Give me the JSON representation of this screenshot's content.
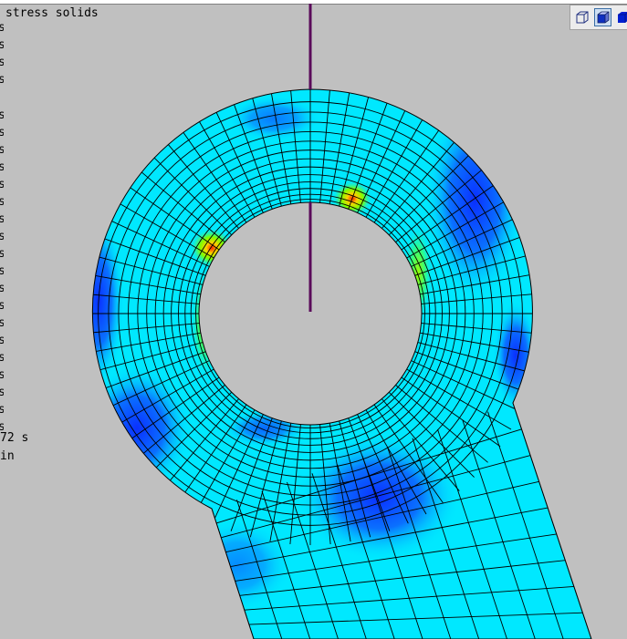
{
  "legend": {
    "title": "stress solids",
    "ticks": [
      "s",
      "s",
      "s",
      "s",
      "s",
      "s",
      "s",
      "s",
      "s",
      "s",
      "s",
      "s",
      "s",
      "s",
      "s",
      "s",
      "s",
      "s",
      "s",
      "s",
      "s",
      "s",
      "s"
    ]
  },
  "info": {
    "time_label": "72 s",
    "unit_label": "in"
  },
  "toolbar": {
    "buttons": [
      {
        "name": "wireframe-view-icon",
        "active": false
      },
      {
        "name": "shaded-view-icon",
        "active": true
      },
      {
        "name": "solid-view-icon",
        "active": false
      }
    ]
  },
  "colors": {
    "background": "#c0c0c0",
    "mesh_lines": "#000000",
    "axis_line": "#5a0a5a",
    "stress_low": "#0a3cff",
    "stress_base": "#00e8ff",
    "stress_mid": "#7cff00",
    "stress_high": "#ff2000"
  }
}
